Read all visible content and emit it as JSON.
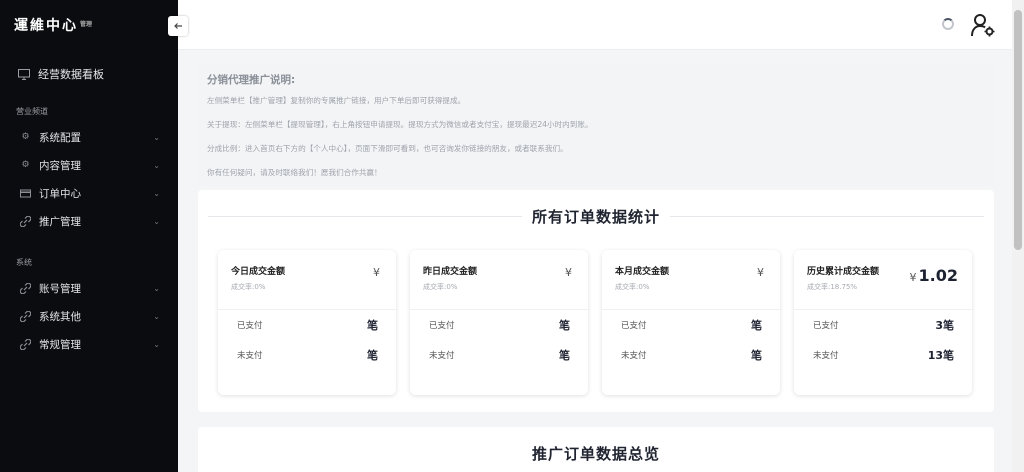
{
  "sidebar": {
    "brand": "運維中心",
    "brand_small": "管理",
    "dashboard": "经营数据看板",
    "section_ops": "营业频道",
    "ops_items": [
      {
        "label": "系统配置",
        "icon": "gear-icon"
      },
      {
        "label": "内容管理",
        "icon": "gear-icon"
      },
      {
        "label": "订单中心",
        "icon": "card-icon"
      },
      {
        "label": "推广管理",
        "icon": "link-icon"
      }
    ],
    "section_sys": "系统",
    "sys_items": [
      {
        "label": "账号管理",
        "icon": "link-icon"
      },
      {
        "label": "系统其他",
        "icon": "link-icon"
      },
      {
        "label": "常规管理",
        "icon": "link-icon"
      }
    ]
  },
  "header": {
    "collapse_icon": "arrow-left-icon",
    "user_icon": "user-settings-icon"
  },
  "notice": {
    "title": "分销代理推广说明:",
    "lines": [
      "左侧菜单栏【推广管理】复制你的专属推广链接，用户下单后即可获得提成。",
      "关于提现：左侧菜单栏【提现管理】，右上角按钮申请提现。提现方式为微信或者支付宝，提现最迟24小时内到账。",
      "分成比例：进入首页右下方的【个人中心】，页面下滑即可看到，也可咨询发你链接的朋友，或者联系我们。",
      "你有任何疑问，请及时联络我们！愿我们合作共赢！"
    ]
  },
  "stats": {
    "title": "所有订单数据统计",
    "paid_label": "已支付",
    "unpaid_label": "未支付",
    "currency": "¥",
    "cards": [
      {
        "label": "今日成交金额",
        "rate": "成交率:0%",
        "amount": "",
        "paid": "笔",
        "unpaid": "笔"
      },
      {
        "label": "昨日成交金额",
        "rate": "成交率:0%",
        "amount": "",
        "paid": "笔",
        "unpaid": "笔"
      },
      {
        "label": "本月成交金额",
        "rate": "成交率:0%",
        "amount": "",
        "paid": "笔",
        "unpaid": "笔"
      },
      {
        "label": "历史累计成交金额",
        "rate": "成交率:18.75%",
        "amount": "1.02",
        "paid": "3笔",
        "unpaid": "13笔"
      }
    ]
  },
  "promo": {
    "title": "推广订单数据总览"
  }
}
